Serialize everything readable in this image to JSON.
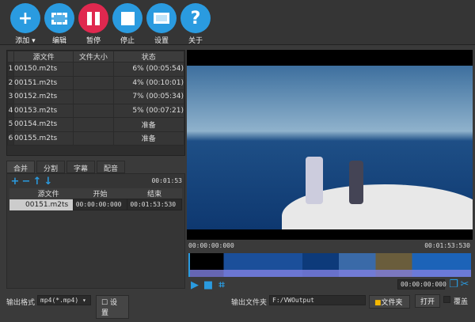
{
  "toolbar": {
    "add": "添加",
    "edit": "编辑",
    "pause": "暂停",
    "stop": "停止",
    "settings": "设置",
    "about": "关于"
  },
  "files": {
    "headers": [
      "源文件",
      "文件大小",
      "状态"
    ],
    "rows": [
      {
        "n": "1",
        "name": "00150.m2ts",
        "size": "",
        "status": "6% (00:05:54)"
      },
      {
        "n": "2",
        "name": "00151.m2ts",
        "size": "",
        "status": "4% (00:10:01)"
      },
      {
        "n": "3",
        "name": "00152.m2ts",
        "size": "",
        "status": "7% (00:05:34)"
      },
      {
        "n": "4",
        "name": "00153.m2ts",
        "size": "",
        "status": "5% (00:07:21)"
      },
      {
        "n": "5",
        "name": "00154.m2ts",
        "size": "",
        "status": "准备"
      },
      {
        "n": "6",
        "name": "00155.m2ts",
        "size": "",
        "status": "准备"
      }
    ]
  },
  "tabs": [
    "合并",
    "分割",
    "字幕",
    "配音"
  ],
  "merge": {
    "duration": "00:01:53",
    "headers": [
      "源文件",
      "开始",
      "结束"
    ],
    "row": {
      "name": "00151.m2ts",
      "start": "00:00:00:000",
      "end": "00:01:53:530"
    }
  },
  "player": {
    "start_time": "00:00:00:000",
    "end_time": "00:01:53:530",
    "position": "00:00:00:000"
  },
  "bottom": {
    "format_label": "输出格式",
    "format_value": "mp4(*.mp4)",
    "settings": "设置",
    "folder_label": "输出文件夹",
    "folder_value": "F:/VWOutput",
    "folder_btn": "文件夹",
    "open_btn": "打开",
    "overwrite": "覆盖"
  }
}
